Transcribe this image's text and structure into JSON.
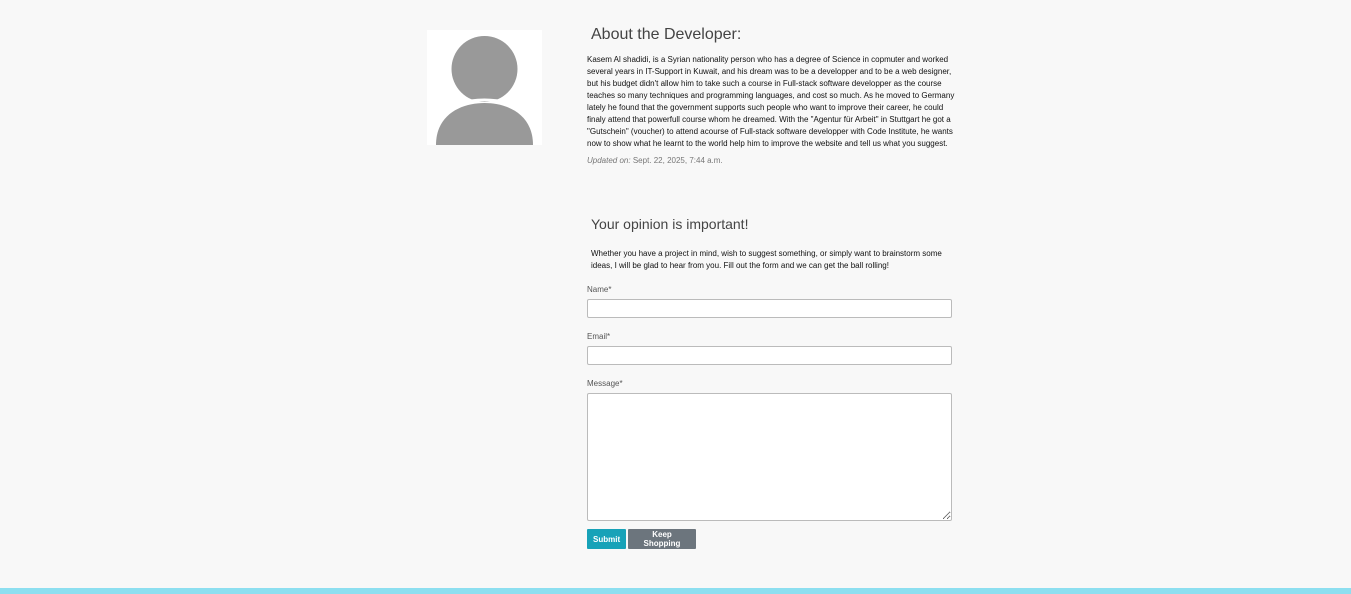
{
  "about": {
    "title": "About the Developer:",
    "bio": "Kasem Al shadidi, is a Syrian nationality person who has a degree of Science in copmuter and worked several years in IT-Support in Kuwait, and his dream was to be a developper and to be a web designer, but his budget didn't allow him to take such a course in Full-stack software developper as the course teaches so many techniques and programming languages, and cost so much. As he moved to Germany lately he found that the government supports such people who want to improve their career, he could finaly attend that powerfull course whom he dreamed. With the \"Agentur für Arbeit\" in Stuttgart he got a \"Gutschein\" (voucher) to attend acourse of Full-stack software developper with Code Institute, he wants now to show what he learnt to the world help him to improve the website and tell us what you suggest.",
    "updated_label": "Updated on:",
    "updated_value": "Sept. 22, 2025, 7:44 a.m."
  },
  "avatar": {
    "icon": "user-silhouette-icon",
    "color": "#999999"
  },
  "opinion": {
    "title": "Your opinion is important!",
    "intro": "Whether you have a project in mind, wish to suggest something, or simply want to brainstorm some ideas, I will be glad to hear from you. Fill out the form and we can get the ball rolling!"
  },
  "form": {
    "name_label": "Name*",
    "name_value": "",
    "email_label": "Email*",
    "email_value": "",
    "message_label": "Message*",
    "message_value": "",
    "submit_label": "Submit",
    "keep_shopping_label": "Keep Shopping"
  },
  "colors": {
    "submit": "#17a2b8",
    "keep_shopping": "#6c757d",
    "footer_bar": "#8ddff0",
    "background": "#f8f8f8"
  }
}
